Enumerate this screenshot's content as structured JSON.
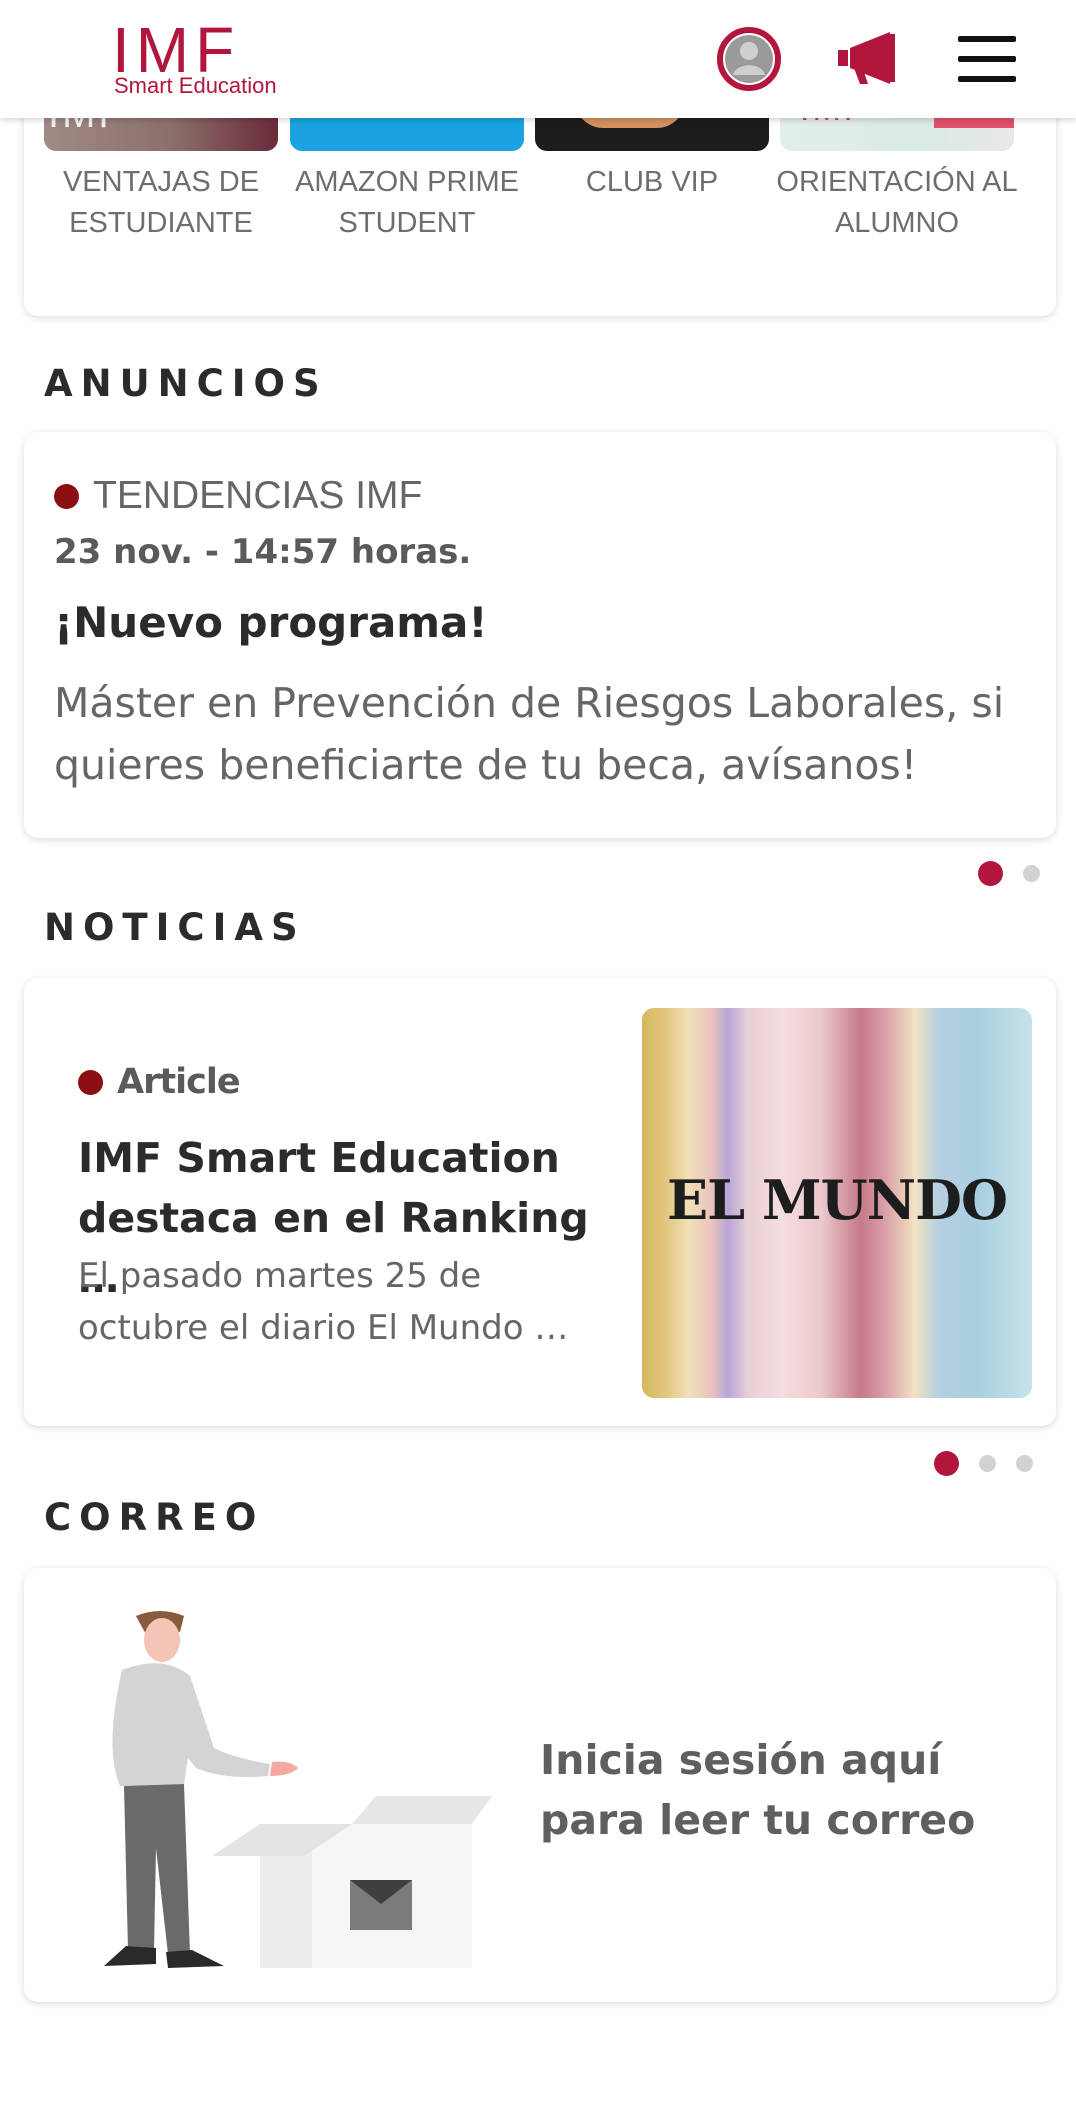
{
  "header": {
    "logo_main": "IMF",
    "logo_sub": "Smart Education",
    "profile_icon": "user-avatar-icon",
    "announce_icon": "megaphone-icon",
    "menu_icon": "hamburger-menu-icon",
    "brand_color": "#b3163c"
  },
  "tiles": [
    {
      "label": "VENTAJAS DE ESTUDIANTE",
      "thumb_text": "IMF",
      "thumb_color": "#8a6a66"
    },
    {
      "label": "AMAZON PRIME STUDENT",
      "thumb_color": "#1aa3e0"
    },
    {
      "label": "CLUB VIP",
      "thumb_color": "#1c1c1c"
    },
    {
      "label": "ORIENTACIÓN AL ALUMNO",
      "thumb_text": "IMF",
      "thumb_color": "#d9ebe3"
    }
  ],
  "announcements": {
    "heading": "ANUNCIOS",
    "item": {
      "category": "TENDENCIAS IMF",
      "date": "23 nov. - 14:57 horas.",
      "title": "¡Nuevo programa!",
      "body": "Máster en Prevención de Riesgos Laborales, si quieres beneficiarte de tu beca, avísanos!"
    },
    "page_count": 2,
    "active_page": 1
  },
  "news": {
    "heading": "NOTICIAS",
    "item": {
      "type": "Article",
      "title": "IMF Smart Education destaca en el Ranking …",
      "body": "El pasado martes 25 de octubre el diario El Mundo …",
      "image_text": "EL MUNDO"
    },
    "page_count": 3,
    "active_page": 1
  },
  "mail": {
    "heading": "CORREO",
    "prompt": "Inicia sesión aquí para leer tu correo"
  }
}
